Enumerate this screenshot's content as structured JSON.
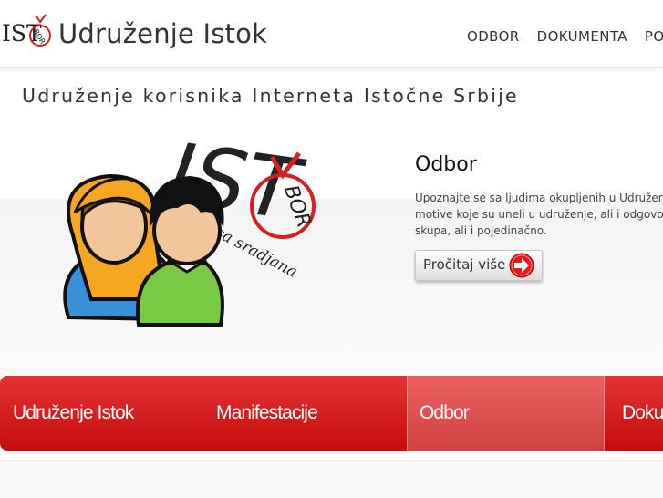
{
  "header": {
    "logo": {
      "text": "IST",
      "badge": "BOR"
    },
    "site_name": "Udruženje Istok",
    "nav": [
      {
        "label": "ODBOR"
      },
      {
        "label": "DOKUMENTA"
      },
      {
        "label": "POS"
      }
    ]
  },
  "tagline": "Udruženje korisnika Interneta Istočne Srbije",
  "illustration": {
    "logo_text": "IST",
    "badge_text": "BOR",
    "script_text": "sa sradjana"
  },
  "feature": {
    "title": "Odbor",
    "lines": [
      "Upoznajte se sa ljudima okupljenih u Udruženj",
      "motive koje su uneli u udruženje, ali i odgovorn",
      "skupa, ali i pojedinačno."
    ],
    "button_label": "Pročitaj više"
  },
  "slider": {
    "tabs": [
      {
        "label": "Udruženje Istok"
      },
      {
        "label": "Manifestacije"
      },
      {
        "label": "Odbor"
      },
      {
        "label": "Doku"
      }
    ]
  },
  "colors": {
    "accent_red": "#d81f1f",
    "text": "#333333"
  }
}
